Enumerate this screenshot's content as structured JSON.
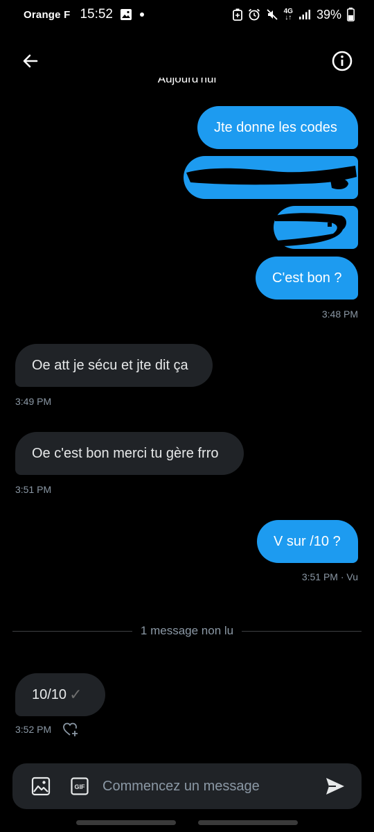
{
  "status_bar": {
    "carrier": "Orange F",
    "time": "15:52",
    "network": "4G",
    "battery": "39%"
  },
  "header": {
    "back_icon": "arrow-left-icon",
    "info_icon": "info-circle-icon"
  },
  "conversation": {
    "day_label": "Aujourd'hui",
    "messages": [
      {
        "direction": "out",
        "text": "Jte donne les codes"
      },
      {
        "direction": "out",
        "text": "",
        "redacted": true
      },
      {
        "direction": "out",
        "text": "",
        "redacted": true
      },
      {
        "direction": "out",
        "text": "C'est bon ?",
        "meta": "3:48 PM"
      },
      {
        "direction": "in",
        "text": "Oe att je sécu et jte dit ça",
        "meta": "3:49 PM"
      },
      {
        "direction": "in",
        "text": "Oe c'est bon merci tu gère frro",
        "meta": "3:51 PM"
      },
      {
        "direction": "out",
        "text": "V sur /10 ?",
        "meta": "3:51 PM · Vu"
      },
      {
        "direction": "in",
        "text": "10/10",
        "suffix": "✓",
        "meta": "3:52 PM"
      }
    ],
    "unread_divider": "1 message non lu"
  },
  "composer": {
    "placeholder": "Commencez un message",
    "media_icon": "image-icon",
    "gif_icon": "gif-icon",
    "send_icon": "send-icon"
  },
  "colors": {
    "background": "#000000",
    "outgoing_bubble": "#1d9bf0",
    "incoming_bubble": "#202327",
    "meta_text": "#8b98a5"
  }
}
